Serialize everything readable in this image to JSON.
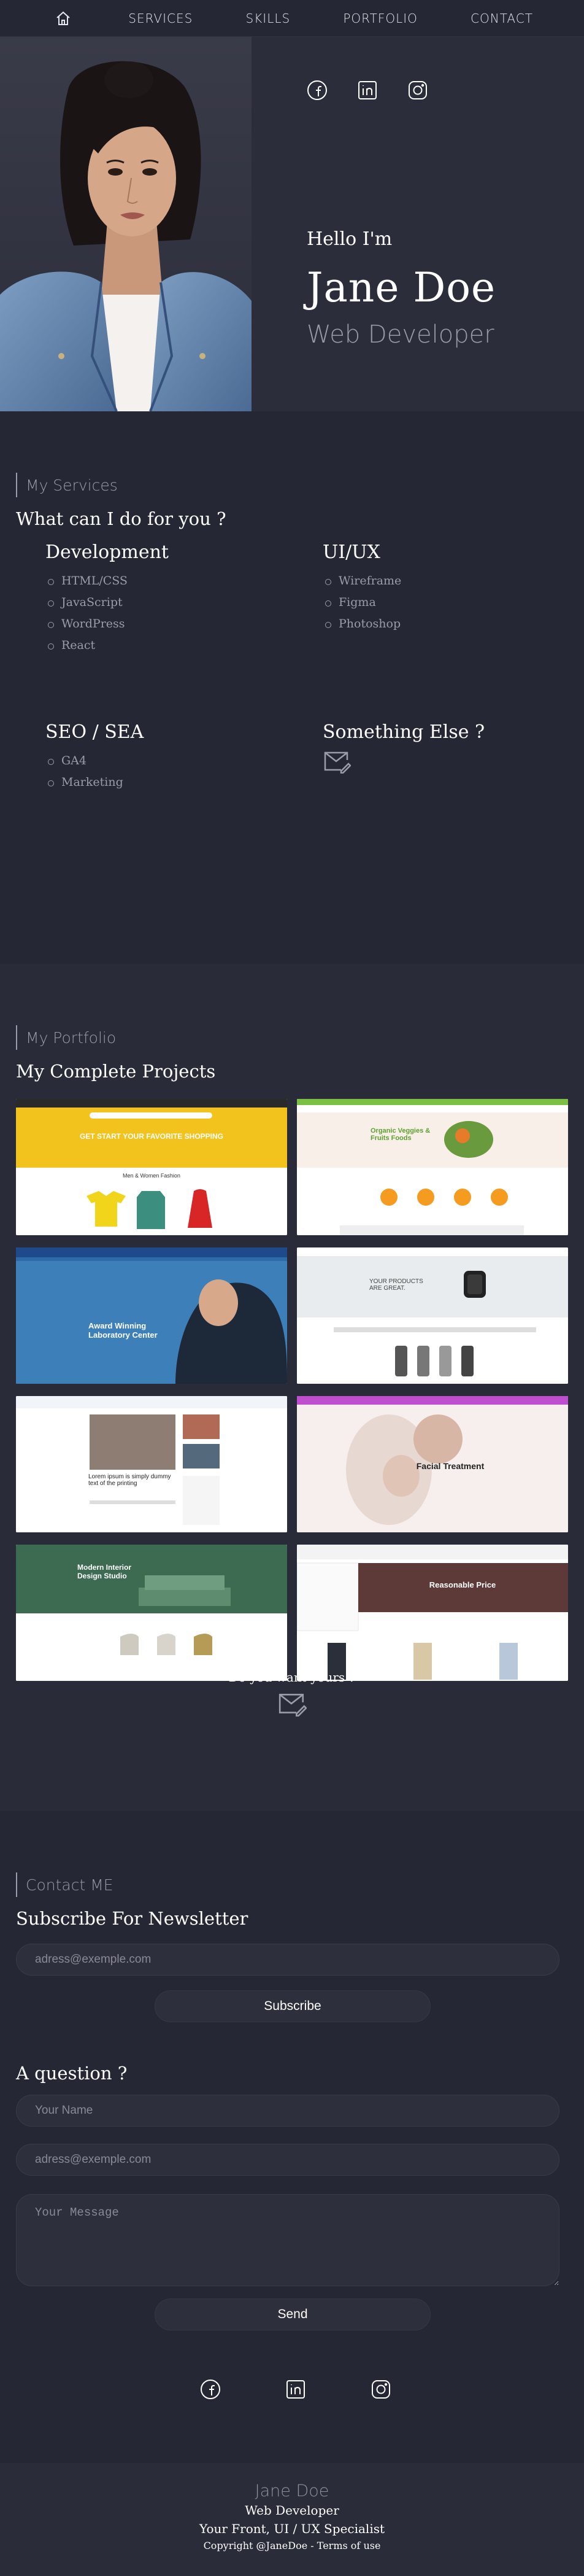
{
  "nav": {
    "home_icon": "home-icon",
    "items": [
      {
        "label": "SERVICES"
      },
      {
        "label": "SKILLS"
      },
      {
        "label": "PORTFOLIO"
      },
      {
        "label": "CONTACT"
      }
    ]
  },
  "hero": {
    "social_icons": [
      "facebook-icon",
      "linkedin-icon",
      "instagram-icon"
    ],
    "greeting": "Hello I'm",
    "name": "Jane Doe",
    "role": "Web Developer"
  },
  "services": {
    "label": "My Services",
    "title": "What can I do for you ?",
    "items": [
      {
        "title": "Development",
        "skills": [
          "HTML/CSS",
          "JavaScript",
          "WordPress",
          "React"
        ]
      },
      {
        "title": "UI/UX",
        "skills": [
          "Wireframe",
          "Figma",
          "Photoshop"
        ]
      },
      {
        "title": "SEO / SEA",
        "skills": [
          "GA4",
          "Marketing"
        ]
      },
      {
        "title": "Something Else ?",
        "icon": "mail-edit-icon"
      }
    ]
  },
  "portfolio": {
    "label": "My Portfolio",
    "title": "My Complete Projects",
    "projects": [
      {
        "caption": "GET START YOUR FAVORITE SHOPPING",
        "sub": "Men & Women Fashion",
        "theme": "#f2c31c"
      },
      {
        "caption": "Organic Veggies & Fruits Foods",
        "theme": "#7cc043"
      },
      {
        "caption": "Award Winning Laboratory Center",
        "theme": "#1e4a8c"
      },
      {
        "caption": "YOUR PRODUCTS ARE GREAT.",
        "theme": "#e9ecef"
      },
      {
        "caption": "Lorem ipsum is simply dummy text of the printing",
        "theme": "#3f6fb5"
      },
      {
        "caption": "Facial Treatment",
        "theme": "#c04fd0"
      },
      {
        "caption": "Modern Interior Design Studio",
        "theme": "#3d6b52"
      },
      {
        "caption": "Reasonable Price",
        "theme": "#d9467a"
      }
    ],
    "cta": "Do you want yours ?",
    "cta_icon": "mail-edit-icon"
  },
  "contact": {
    "label": "Contact ME",
    "newsletter_title": "Subscribe For Newsletter",
    "newsletter_placeholder": "adress@exemple.com",
    "subscribe_label": "Subscribe",
    "question_title": "A question ?",
    "name_placeholder": "Your Name",
    "email_placeholder": "adress@exemple.com",
    "message_placeholder": "Your Message",
    "send_label": "Send",
    "social_icons": [
      "facebook-icon",
      "linkedin-icon",
      "instagram-icon"
    ]
  },
  "footer": {
    "name": "Jane Doe",
    "role": "Web Developer",
    "specialist": "Your Front, UI / UX Specialist",
    "copyright": "Copyright @JaneDoe - Terms of use"
  }
}
